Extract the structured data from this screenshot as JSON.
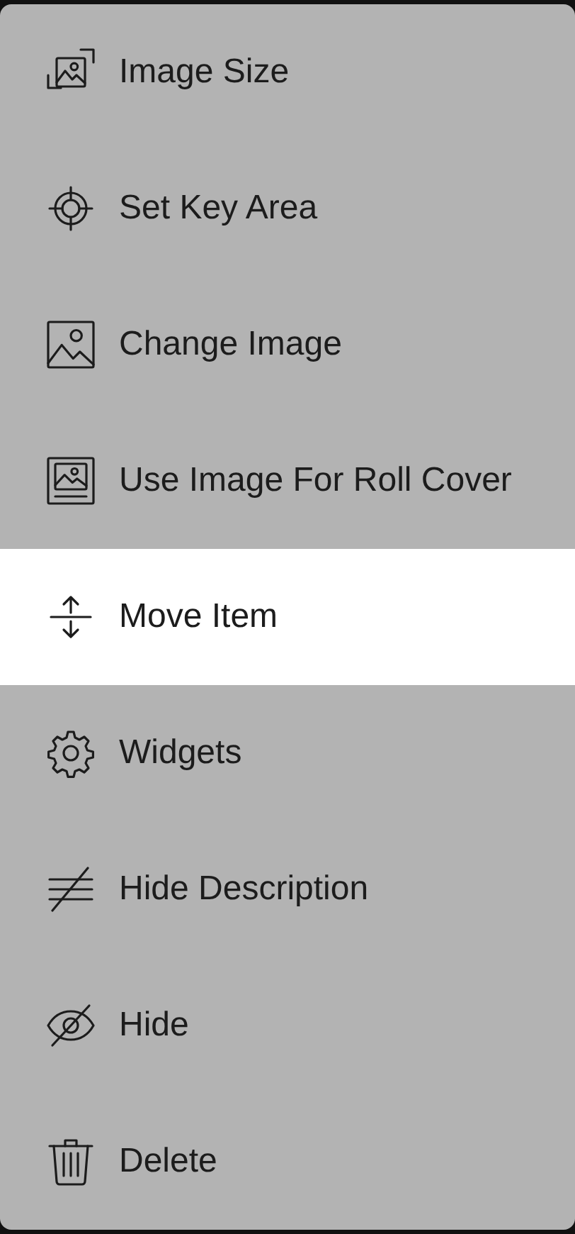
{
  "menu": {
    "items": [
      {
        "label": "Image Size",
        "selected": false
      },
      {
        "label": "Set Key Area",
        "selected": false
      },
      {
        "label": "Change Image",
        "selected": false
      },
      {
        "label": "Use Image For Roll Cover",
        "selected": false
      },
      {
        "label": "Move Item",
        "selected": true
      },
      {
        "label": "Widgets",
        "selected": false
      },
      {
        "label": "Hide Description",
        "selected": false
      },
      {
        "label": "Hide",
        "selected": false
      },
      {
        "label": "Delete",
        "selected": false
      }
    ]
  }
}
